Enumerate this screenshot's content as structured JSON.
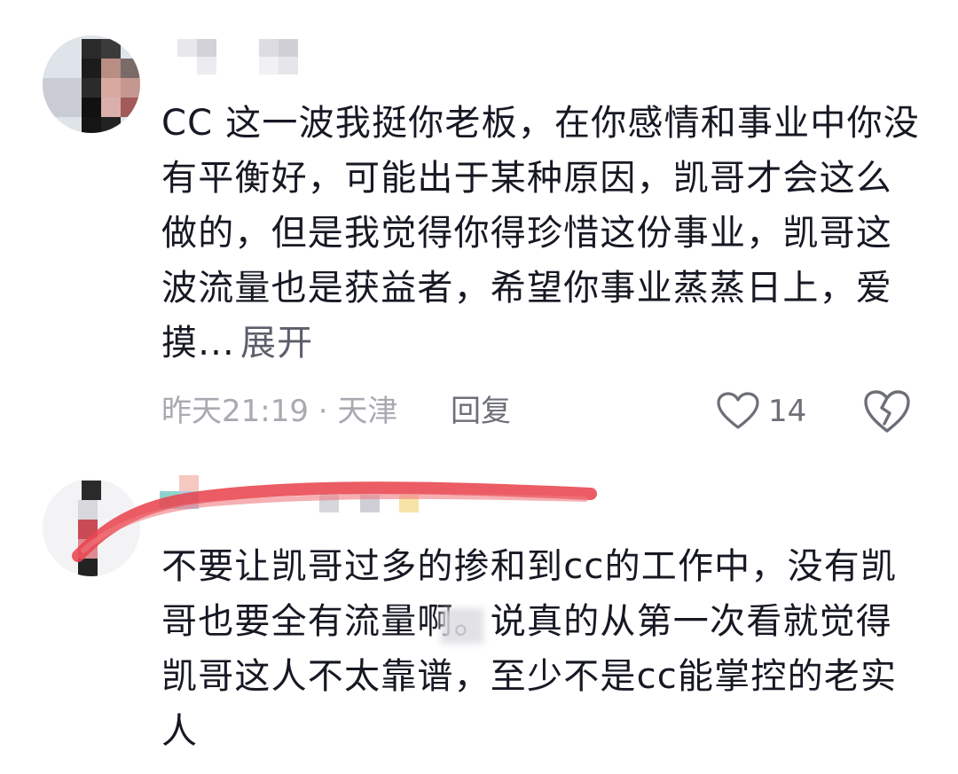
{
  "comments": [
    {
      "text": "CC 这一波我挺你老板，在你感情和事业中你没有平衡好，可能出于某种原因，凯哥才会这么做的，但是我觉得你得珍惜这份事业，凯哥这波流量也是获益者，希望你事业蒸蒸日上，爱摸...",
      "expand_label": "展开",
      "time_location": "昨天21:19 · 天津",
      "reply_label": "回复",
      "like_count": "14",
      "like_icon": "heart-outline-icon",
      "dislike_icon": "broken-heart-icon"
    },
    {
      "text": "不要让凯哥过多的掺和到cc的工作中，没有凯哥也要全有流量啊。说真的从第一次看就觉得凯哥这人不太靠谱，至少不是cc能掌控的老实人"
    }
  ],
  "colors": {
    "text": "#161823",
    "meta": "#a9aab1",
    "action": "#6d6f78",
    "redaction_stroke": "#e8454f"
  }
}
